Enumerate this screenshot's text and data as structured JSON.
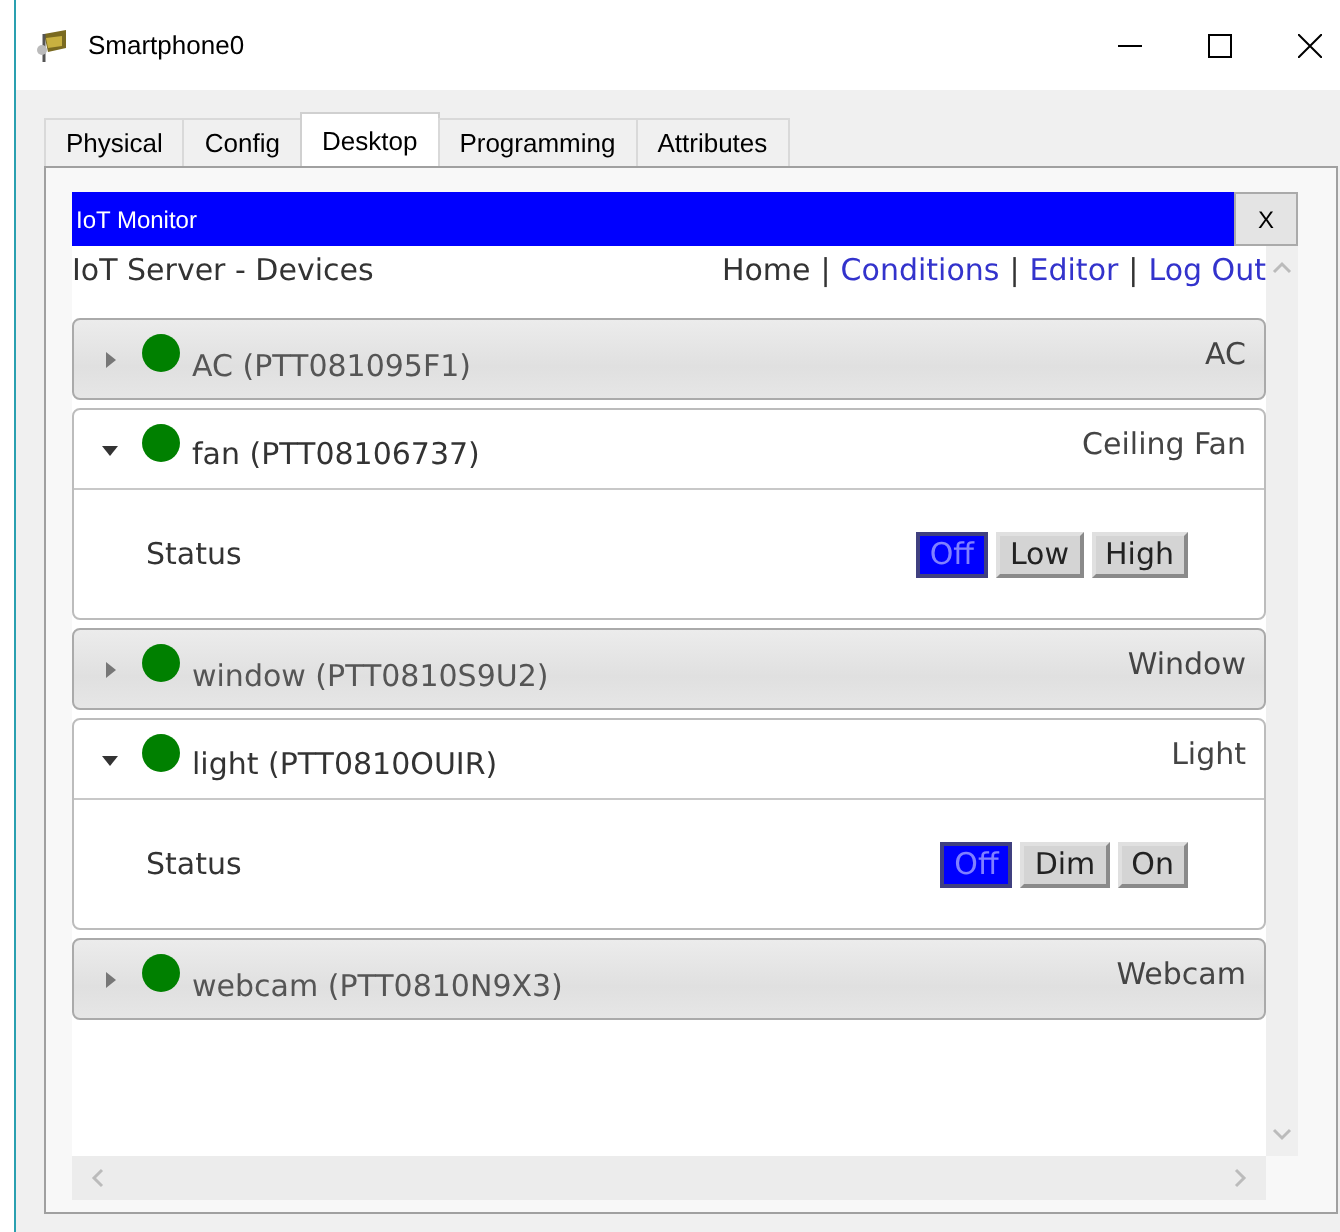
{
  "window": {
    "title": "Smartphone0"
  },
  "tabs": [
    {
      "label": "Physical",
      "selected": false
    },
    {
      "label": "Config",
      "selected": false
    },
    {
      "label": "Desktop",
      "selected": true
    },
    {
      "label": "Programming",
      "selected": false
    },
    {
      "label": "Attributes",
      "selected": false
    }
  ],
  "monitor": {
    "title": "IoT Monitor",
    "close": "X",
    "heading": "IoT Server - Devices",
    "separator": "|",
    "nav": [
      {
        "label": "Home",
        "kind": "current"
      },
      {
        "label": "Conditions",
        "kind": "link"
      },
      {
        "label": "Editor",
        "kind": "link"
      },
      {
        "label": "Log Out",
        "kind": "link"
      }
    ]
  },
  "devices": [
    {
      "name": "AC (PTT081095F1)",
      "type": "AC",
      "expanded": false,
      "color": "#008000"
    },
    {
      "name": "fan (PTT08106737)",
      "type": "Ceiling Fan",
      "expanded": true,
      "color": "#008000",
      "status_label": "Status",
      "options": [
        {
          "label": "Off",
          "selected": true
        },
        {
          "label": "Low",
          "selected": false
        },
        {
          "label": "High",
          "selected": false
        }
      ]
    },
    {
      "name": "window (PTT0810S9U2)",
      "type": "Window",
      "expanded": false,
      "color": "#008000"
    },
    {
      "name": "light (PTT0810OUIR)",
      "type": "Light",
      "expanded": true,
      "color": "#008000",
      "status_label": "Status",
      "options": [
        {
          "label": "Off",
          "selected": true
        },
        {
          "label": "Dim",
          "selected": false
        },
        {
          "label": "On",
          "selected": false
        }
      ]
    },
    {
      "name": "webcam (PTT0810N9X3)",
      "type": "Webcam",
      "expanded": false,
      "color": "#008000"
    }
  ]
}
